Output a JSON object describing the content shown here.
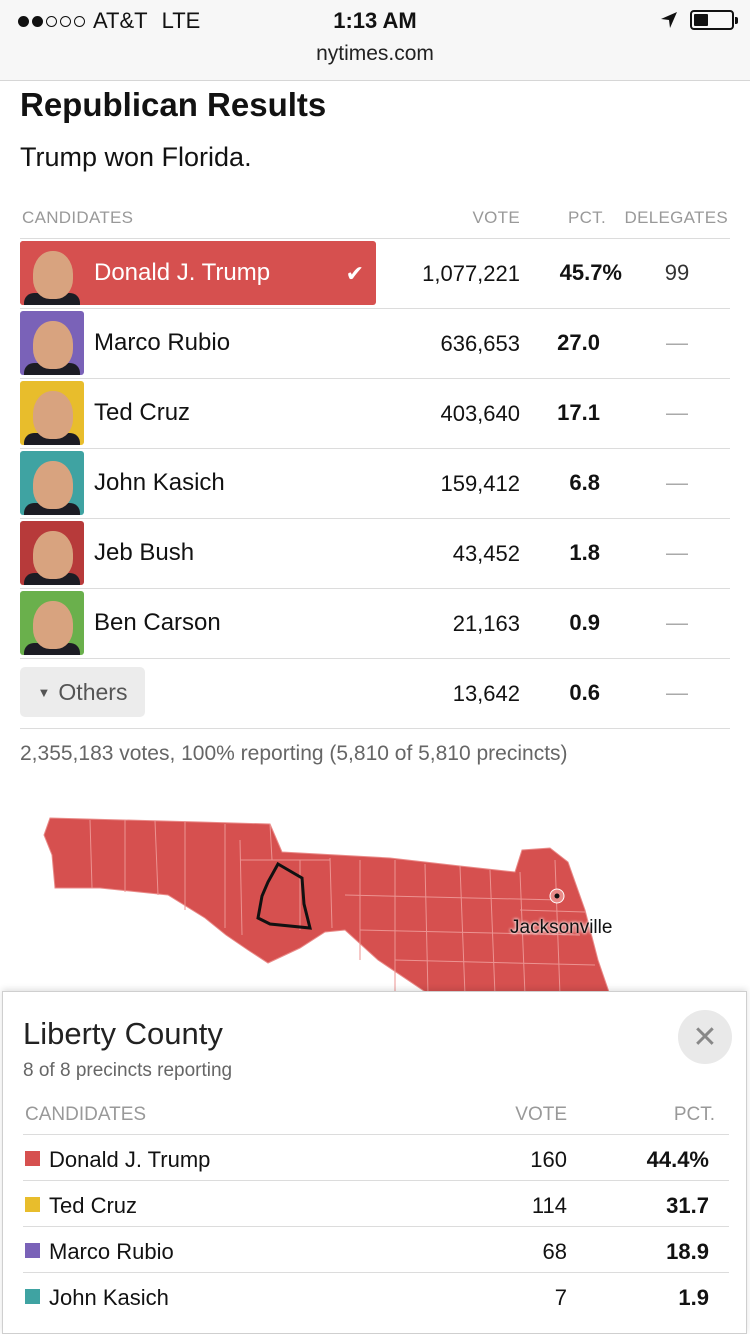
{
  "status": {
    "carrier": "AT&T",
    "network": "LTE",
    "time": "1:13 AM",
    "url": "nytimes.com",
    "signal_bars": 2
  },
  "header": {
    "title": "Republican Results",
    "subtitle": "Trump won Florida."
  },
  "table": {
    "columns": {
      "candidates": "CANDIDATES",
      "vote": "VOTE",
      "pct": "PCT.",
      "delegates": "DELEGATES"
    },
    "rows": [
      {
        "name": "Donald J. Trump",
        "vote": "1,077,221",
        "pct": "45.7%",
        "delegates": "99",
        "winner": true,
        "photo_color": "#d6504f"
      },
      {
        "name": "Marco Rubio",
        "vote": "636,653",
        "pct": "27.0",
        "delegates": "—",
        "photo_color": "#7a62b8"
      },
      {
        "name": "Ted Cruz",
        "vote": "403,640",
        "pct": "17.1",
        "delegates": "—",
        "photo_color": "#e8bd2c"
      },
      {
        "name": "John Kasich",
        "vote": "159,412",
        "pct": "6.8",
        "delegates": "—",
        "photo_color": "#3fa3a2"
      },
      {
        "name": "Jeb Bush",
        "vote": "43,452",
        "pct": "1.8",
        "delegates": "—",
        "photo_color": "#b73a3a"
      },
      {
        "name": "Ben Carson",
        "vote": "21,163",
        "pct": "0.9",
        "delegates": "—",
        "photo_color": "#6ab04c"
      }
    ],
    "others": {
      "label": "Others",
      "vote": "13,642",
      "pct": "0.6",
      "delegates": "—"
    }
  },
  "summary": "2,355,183 votes, 100% reporting (5,810 of 5,810 precincts)",
  "map": {
    "city_label": "Jacksonville",
    "fill_color": "#d6504f"
  },
  "county": {
    "title": "Liberty County",
    "subtitle": "8 of 8 precincts reporting",
    "columns": {
      "candidates": "CANDIDATES",
      "vote": "VOTE",
      "pct": "PCT."
    },
    "rows": [
      {
        "name": "Donald J. Trump",
        "vote": "160",
        "pct": "44.4%",
        "color": "#d6504f"
      },
      {
        "name": "Ted Cruz",
        "vote": "114",
        "pct": "31.7",
        "color": "#e8bd2c"
      },
      {
        "name": "Marco Rubio",
        "vote": "68",
        "pct": "18.9",
        "color": "#7a62b8"
      },
      {
        "name": "John Kasich",
        "vote": "7",
        "pct": "1.9",
        "color": "#3fa3a2"
      }
    ]
  }
}
